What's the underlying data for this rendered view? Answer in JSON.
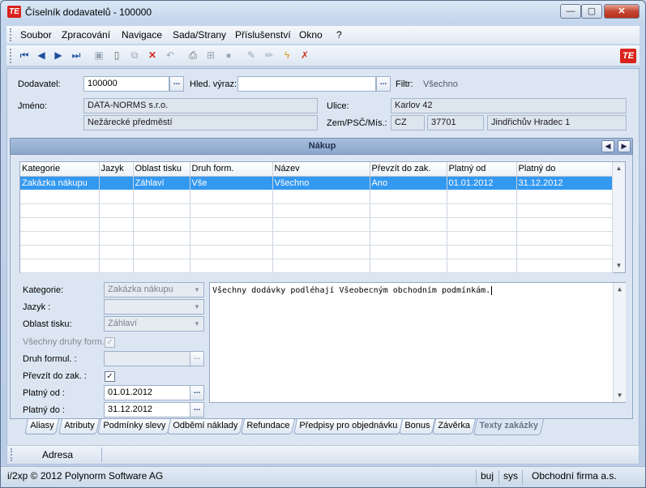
{
  "window": {
    "title": "Číselník dodavatelů - 100000",
    "logo": "TE"
  },
  "menu": [
    "Soubor",
    "Zpracování",
    "Navigace",
    "Sada/Strany",
    "Příslušenství",
    "Okno",
    "?"
  ],
  "toolbar_icons": [
    "first-icon",
    "prev-icon",
    "next-icon",
    "last-icon",
    "save-icon",
    "new-icon",
    "copy-icon",
    "delete-icon",
    "undo-icon",
    "print-icon",
    "tree-icon",
    "stop-icon",
    "edit-icon",
    "pencil-icon",
    "lightning-icon",
    "clear-icon"
  ],
  "header": {
    "dodavatel_label": "Dodavatel:",
    "dodavatel_value": "100000",
    "hled_label": "Hled. výraz:",
    "hled_value": "",
    "filtr_label": "Filtr:",
    "filtr_value": "Všechno",
    "jmeno_label": "Jméno:",
    "jmeno_value": "DATA-NORMS s.r.o.",
    "jmeno2_value": "Nežárecké předměstí",
    "ulice_label": "Ulice:",
    "ulice_value": "Karlov 42",
    "zem_label": "Zem/PSČ/Mís.:",
    "zem_value": "CZ",
    "psc_value": "37701",
    "misto_value": "Jindřichův Hradec 1",
    "dots": "..."
  },
  "panel": {
    "title": "Nákup"
  },
  "grid": {
    "columns": [
      "Kategorie",
      "Jazyk",
      "Oblast tisku",
      "Druh form.",
      "Název",
      "Převzít do zak.",
      "Platný od",
      "Platný do"
    ],
    "rows": [
      [
        "Zakázka nákupu",
        "",
        "Záhlaví",
        "Vše",
        "Všechno",
        "Ano",
        "01.01.2012",
        "31.12.2012"
      ]
    ]
  },
  "form": {
    "kategorie_label": "Kategorie:",
    "kategorie_value": "Zakázka nákupu",
    "jazyk_label": "Jazyk  :",
    "jazyk_value": "",
    "oblast_label": "Oblast tisku:",
    "oblast_value": "Záhlaví",
    "vsechny_label": "Všechny druhy form.:",
    "druh_label": "Druh formul. :",
    "druh_value": "",
    "prevzit_label": "Převzít do zak. :",
    "platny_od_label": "Platný od :",
    "platny_od_value": "01.01.2012",
    "platny_do_label": "Platný do :",
    "platny_do_value": "31.12.2012",
    "check": "✓"
  },
  "note_text": "Všechny dodávky podléhají Všeobecným obchodním podmínkám.",
  "tabs": [
    "Aliasy",
    "Atributy",
    "Podmínky slevy",
    "Odběmí náklady",
    "Refundace",
    "Předpisy pro objednávku",
    "Bonus",
    "Závěrka",
    "Texty zakázky"
  ],
  "address_tab": "Adresa",
  "status": {
    "copyright": "i/2xp © 2012 Polynorm Software AG",
    "user": "buj",
    "db": "sys",
    "company": "Obchodní firma a.s."
  }
}
